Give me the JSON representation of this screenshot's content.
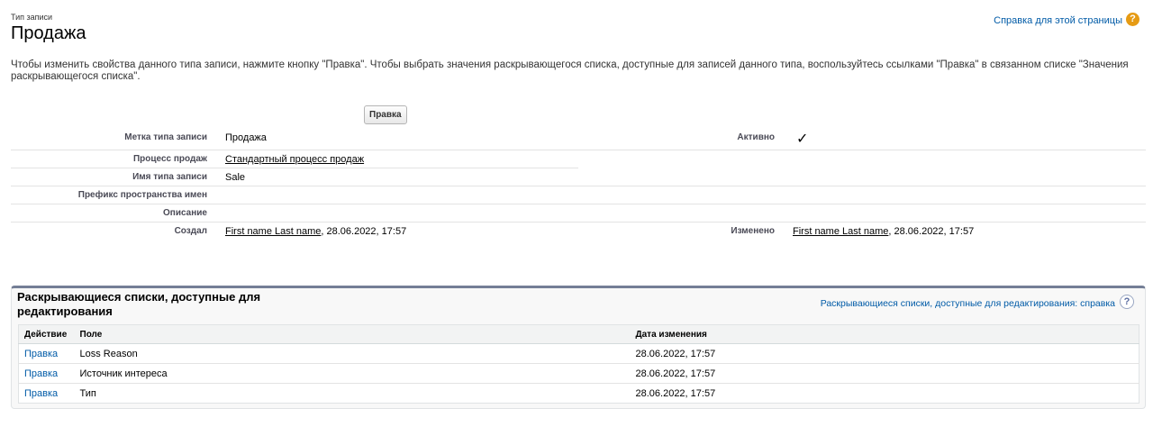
{
  "header": {
    "page_type": "Тип записи",
    "title": "Продажа",
    "help_link": "Справка для этой страницы",
    "help_icon": "help-icon"
  },
  "intro_text": "Чтобы изменить свойства данного типа записи, нажмите кнопку \"Правка\". Чтобы выбрать значения раскрывающегося списка, доступные для записей данного типа, воспользуйтесь ссылками \"Правка\" в связанном списке \"Значения раскрывающегося списка\".",
  "edit_button": "Правка",
  "details": {
    "label_label": "Метка типа записи",
    "label_value": "Продажа",
    "active_label": "Активно",
    "active_value": true,
    "process_label": "Процесс продаж",
    "process_value": "Стандартный процесс продаж",
    "name_label": "Имя типа записи",
    "name_value": "Sale",
    "namespace_label": "Префикс пространства имен",
    "namespace_value": "",
    "description_label": "Описание",
    "description_value": "",
    "created_label": "Создал",
    "created_user": "First name Last name",
    "created_date": ", 28.06.2022, 17:57",
    "modified_label": "Изменено",
    "modified_user": "First name Last name",
    "modified_date": ", 28.06.2022, 17:57"
  },
  "related_list": {
    "title": "Раскрывающиеся списки, доступные для редактирования",
    "help_link": "Раскрывающиеся списки, доступные для редактирования: справка",
    "columns": {
      "action": "Действие",
      "field": "Поле",
      "modified": "Дата изменения"
    },
    "rows": [
      {
        "action": "Правка",
        "field": "Loss Reason",
        "modified": "28.06.2022, 17:57"
      },
      {
        "action": "Правка",
        "field": "Источник интереса",
        "modified": "28.06.2022, 17:57"
      },
      {
        "action": "Правка",
        "field": "Тип",
        "modified": "28.06.2022, 17:57"
      }
    ]
  },
  "colors": {
    "link": "#015ba7",
    "help_orange": "#e69b14",
    "related_border": "#747e96"
  }
}
